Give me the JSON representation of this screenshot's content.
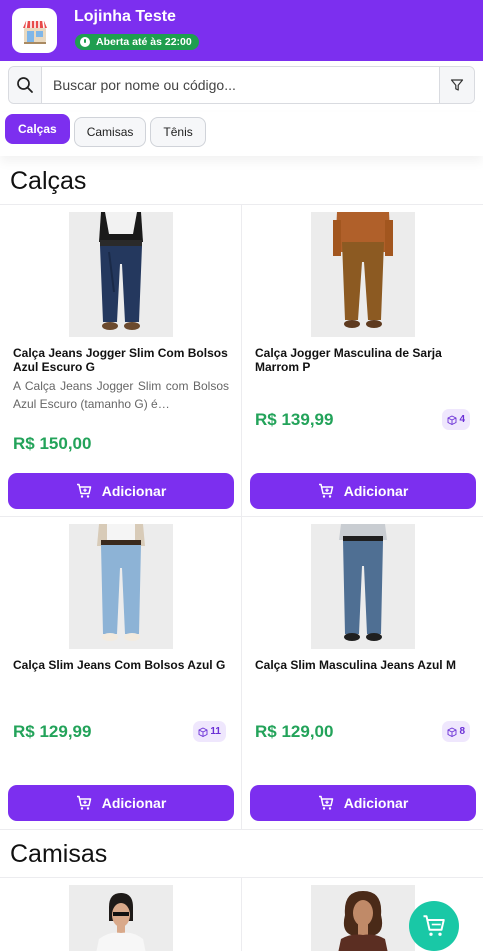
{
  "header": {
    "store_name": "Lojinha Teste",
    "status": "Aberta até às 22:00",
    "logo_icon": "storefront-icon",
    "color": "#7c2fef"
  },
  "search": {
    "placeholder": "Buscar por nome ou código...",
    "value": "",
    "icon": "search-icon",
    "filter_icon": "filter-icon"
  },
  "tabs": [
    {
      "label": "Calças",
      "active": true
    },
    {
      "label": "Camisas",
      "active": false
    },
    {
      "label": "Tênis",
      "active": false
    }
  ],
  "sections": [
    {
      "title": "Calças",
      "products": [
        {
          "name": "Calça Jeans Jogger Slim Com Bolsos Azul Escuro G",
          "description": "A Calça Jeans Jogger Slim com Bolsos Azul Escuro (tamanho G) é…",
          "price": "R$ 150,00",
          "stock": "",
          "image": "dark-jogger-jeans-photo",
          "button": "Adicionar"
        },
        {
          "name": "Calça Jogger Masculina de Sarja Marrom P",
          "description": "",
          "price": "R$ 139,99",
          "stock": "4",
          "image": "brown-jogger-photo",
          "button": "Adicionar"
        },
        {
          "name": "Calça Slim Jeans Com Bolsos Azul G",
          "description": "",
          "price": "R$ 129,99",
          "stock": "11",
          "image": "light-slim-jeans-photo",
          "button": "Adicionar"
        },
        {
          "name": "Calça Slim Masculina Jeans Azul M",
          "description": "",
          "price": "R$ 129,00",
          "stock": "8",
          "image": "blue-slim-jeans-photo",
          "button": "Adicionar"
        }
      ]
    },
    {
      "title": "Camisas",
      "products": [
        {
          "image": "white-shirt-photo"
        },
        {
          "image": "brown-shirt-photo"
        }
      ]
    }
  ],
  "cart_fab": {
    "icon": "cart-icon",
    "color": "#19c8a6"
  },
  "colors": {
    "accent": "#7c2fef",
    "price": "#23a35a",
    "status": "#1f9e4f"
  }
}
